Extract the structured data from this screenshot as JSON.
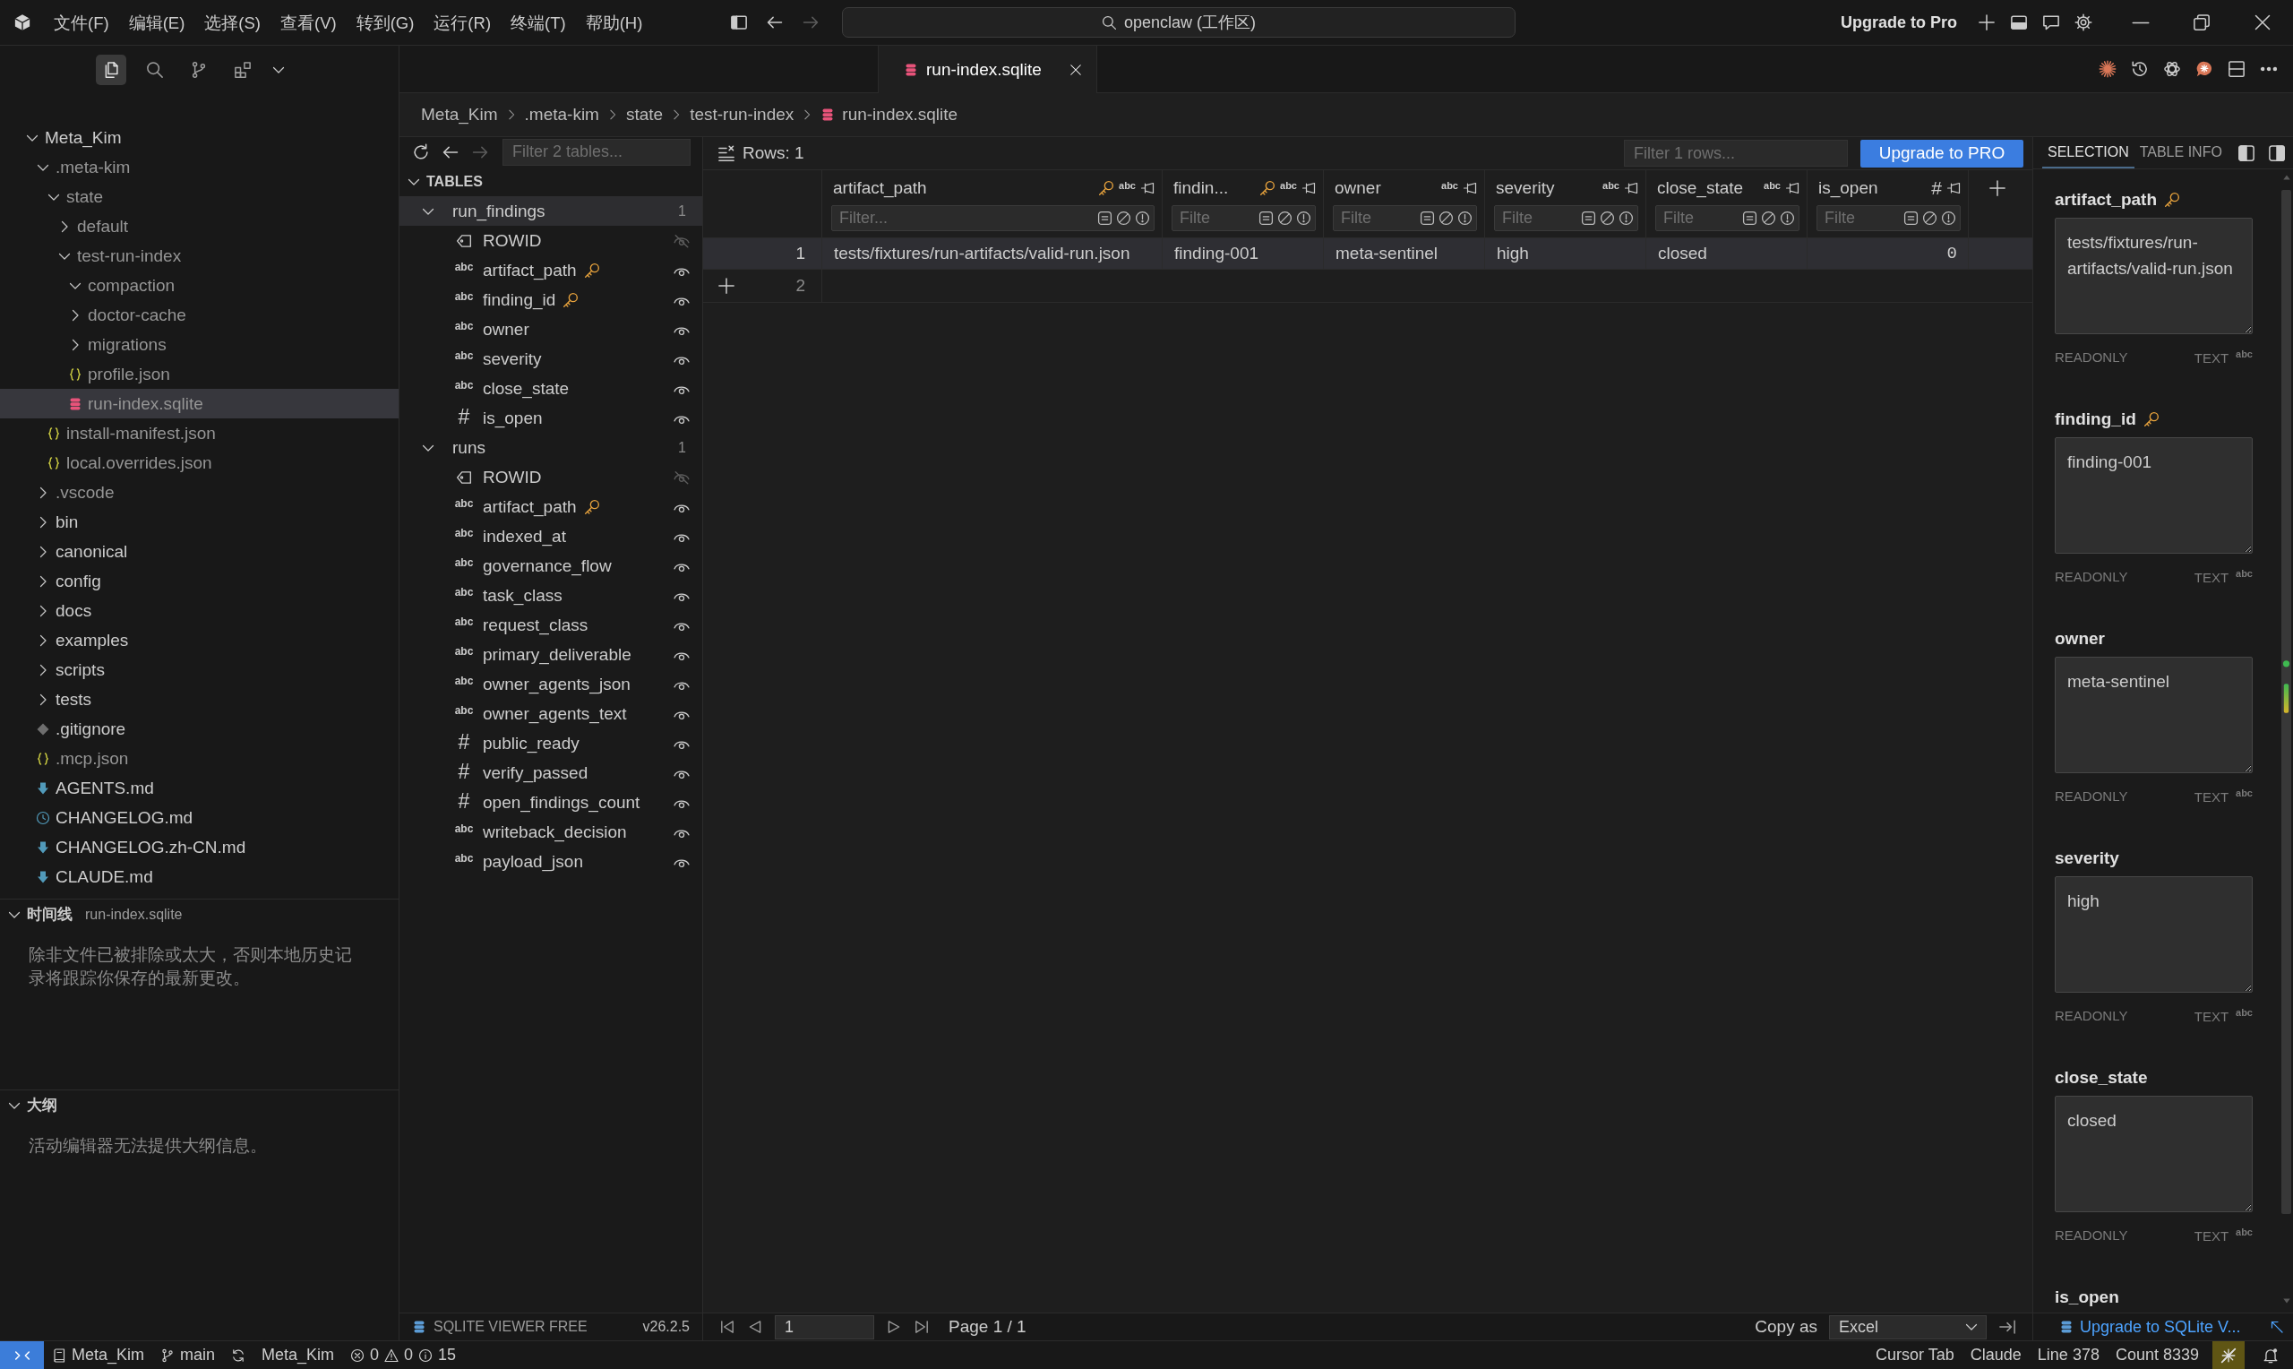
{
  "title_bar": {
    "menu": [
      "文件(F)",
      "编辑(E)",
      "选择(S)",
      "查看(V)",
      "转到(G)",
      "运行(R)",
      "终端(T)",
      "帮助(H)"
    ],
    "search": "openclaw (工作区)",
    "upgrade": "Upgrade to Pro"
  },
  "sidebar": {
    "views": [
      {
        "kind": "explorer",
        "selected": true
      },
      {
        "kind": "search",
        "selected": false
      },
      {
        "kind": "source-control",
        "selected": false
      },
      {
        "kind": "extensions",
        "selected": false
      }
    ],
    "tree": [
      {
        "label": "Meta_Kim",
        "kind": "folder",
        "expanded": true,
        "dimmed": false,
        "selected": false,
        "children": [
          {
            "label": ".meta-kim",
            "kind": "folder",
            "expanded": true,
            "dimmed": true,
            "selected": false,
            "children": [
              {
                "label": "state",
                "kind": "folder",
                "expanded": true,
                "dimmed": true,
                "selected": false,
                "children": [
                  {
                    "label": "default",
                    "kind": "folder",
                    "expanded": false,
                    "dimmed": true,
                    "selected": false
                  },
                  {
                    "label": "test-run-index",
                    "kind": "folder",
                    "expanded": true,
                    "dimmed": true,
                    "selected": false,
                    "children": [
                      {
                        "label": "compaction",
                        "kind": "folder",
                        "expanded": true,
                        "dimmed": true,
                        "selected": false
                      },
                      {
                        "label": "doctor-cache",
                        "kind": "folder",
                        "expanded": false,
                        "dimmed": true,
                        "selected": false
                      },
                      {
                        "label": "migrations",
                        "kind": "folder",
                        "expanded": false,
                        "dimmed": true,
                        "selected": false
                      },
                      {
                        "label": "profile.json",
                        "kind": "json",
                        "dimmed": true,
                        "selected": false
                      },
                      {
                        "label": "run-index.sqlite",
                        "kind": "sqlite",
                        "dimmed": true,
                        "selected": true
                      }
                    ]
                  }
                ]
              },
              {
                "label": "install-manifest.json",
                "kind": "json",
                "dimmed": true,
                "selected": false
              },
              {
                "label": "local.overrides.json",
                "kind": "json",
                "dimmed": true,
                "selected": false
              }
            ]
          },
          {
            "label": ".vscode",
            "kind": "folder",
            "expanded": false,
            "dimmed": true,
            "selected": false
          },
          {
            "label": "bin",
            "kind": "folder",
            "expanded": false,
            "dimmed": false,
            "selected": false
          },
          {
            "label": "canonical",
            "kind": "folder",
            "expanded": false,
            "dimmed": false,
            "selected": false
          },
          {
            "label": "config",
            "kind": "folder",
            "expanded": false,
            "dimmed": false,
            "selected": false
          },
          {
            "label": "docs",
            "kind": "folder",
            "expanded": false,
            "dimmed": false,
            "selected": false
          },
          {
            "label": "examples",
            "kind": "folder",
            "expanded": false,
            "dimmed": false,
            "selected": false
          },
          {
            "label": "scripts",
            "kind": "folder",
            "expanded": false,
            "dimmed": false,
            "selected": false
          },
          {
            "label": "tests",
            "kind": "folder",
            "expanded": false,
            "dimmed": false,
            "selected": false
          },
          {
            "label": ".gitignore",
            "kind": "git",
            "dimmed": false,
            "selected": false
          },
          {
            "label": ".mcp.json",
            "kind": "json",
            "dimmed": true,
            "selected": false
          },
          {
            "label": "AGENTS.md",
            "kind": "markdown",
            "dimmed": false,
            "selected": false
          },
          {
            "label": "CHANGELOG.md",
            "kind": "changelog",
            "dimmed": false,
            "selected": false
          },
          {
            "label": "CHANGELOG.zh-CN.md",
            "kind": "markdown",
            "dimmed": false,
            "selected": false
          },
          {
            "label": "CLAUDE.md",
            "kind": "markdown",
            "dimmed": false,
            "selected": false
          }
        ]
      }
    ],
    "timeline": {
      "title": "时间线",
      "expanded": true,
      "file": "run-index.sqlite",
      "message": "除非文件已被排除或太大，否则本地历史记录将跟踪你保存的最新更改。"
    },
    "outline": {
      "title": "大纲",
      "expanded": true,
      "message": "活动编辑器无法提供大纲信息。"
    }
  },
  "editor": {
    "tabs": [
      {
        "label": "run-index.sqlite",
        "kind": "sqlite",
        "selected": true
      }
    ],
    "breadcrumb": [
      {
        "label": "Meta_Kim",
        "kind": "folder"
      },
      {
        "label": ".meta-kim",
        "kind": "folder"
      },
      {
        "label": "state",
        "kind": "folder"
      },
      {
        "label": "test-run-index",
        "kind": "folder"
      },
      {
        "label": "run-index.sqlite",
        "kind": "sqlite"
      }
    ]
  },
  "tables_panel": {
    "filter_placeholder": "Filter 2 tables...",
    "heading": "TABLES",
    "expanded": true,
    "tables": [
      {
        "name": "run_findings",
        "count": "1",
        "expanded": true,
        "selected": true,
        "columns": [
          {
            "name": "ROWID",
            "kind": "rowid",
            "key": false,
            "visible": false
          },
          {
            "name": "artifact_path",
            "kind": "text",
            "type_label": "abc",
            "key": true,
            "visible": true
          },
          {
            "name": "finding_id",
            "kind": "text",
            "type_label": "abc",
            "key": true,
            "visible": true
          },
          {
            "name": "owner",
            "kind": "text",
            "type_label": "abc",
            "key": false,
            "visible": true
          },
          {
            "name": "severity",
            "kind": "text",
            "type_label": "abc",
            "key": false,
            "visible": true
          },
          {
            "name": "close_state",
            "kind": "text",
            "type_label": "abc",
            "key": false,
            "visible": true
          },
          {
            "name": "is_open",
            "kind": "integer",
            "type_label": "#",
            "key": false,
            "visible": true
          }
        ]
      },
      {
        "name": "runs",
        "count": "1",
        "expanded": true,
        "selected": false,
        "columns": [
          {
            "name": "ROWID",
            "kind": "rowid",
            "key": false,
            "visible": false
          },
          {
            "name": "artifact_path",
            "kind": "text",
            "type_label": "abc",
            "key": true,
            "visible": true
          },
          {
            "name": "indexed_at",
            "kind": "text",
            "type_label": "abc",
            "key": false,
            "visible": true
          },
          {
            "name": "governance_flow",
            "kind": "text",
            "type_label": "abc",
            "key": false,
            "visible": true
          },
          {
            "name": "task_class",
            "kind": "text",
            "type_label": "abc",
            "key": false,
            "visible": true
          },
          {
            "name": "request_class",
            "kind": "text",
            "type_label": "abc",
            "key": false,
            "visible": true
          },
          {
            "name": "primary_deliverable",
            "kind": "text",
            "type_label": "abc",
            "key": false,
            "visible": true
          },
          {
            "name": "owner_agents_json",
            "kind": "text",
            "type_label": "abc",
            "key": false,
            "visible": true
          },
          {
            "name": "owner_agents_text",
            "kind": "text",
            "type_label": "abc",
            "key": false,
            "visible": true
          },
          {
            "name": "public_ready",
            "kind": "integer",
            "type_label": "#",
            "key": false,
            "visible": true
          },
          {
            "name": "verify_passed",
            "kind": "integer",
            "type_label": "#",
            "key": false,
            "visible": true
          },
          {
            "name": "open_findings_count",
            "kind": "integer",
            "type_label": "#",
            "key": false,
            "visible": true
          },
          {
            "name": "writeback_decision",
            "kind": "text",
            "type_label": "abc",
            "key": false,
            "visible": true
          },
          {
            "name": "payload_json",
            "kind": "text",
            "type_label": "abc",
            "key": false,
            "visible": true
          }
        ]
      }
    ]
  },
  "grid": {
    "rows_label": "Rows: 1",
    "filter_placeholder": "Filter 1 rows...",
    "upgrade_button": "Upgrade to PRO",
    "columns": [
      {
        "name": "artifact_path",
        "kind": "text",
        "type_label": "abc",
        "key": true,
        "filter_placeholder": "Filter..."
      },
      {
        "name": "findin...",
        "kind": "text",
        "type_label": "abc",
        "key": true,
        "filter_placeholder": "Filte"
      },
      {
        "name": "owner",
        "kind": "text",
        "type_label": "abc",
        "key": false,
        "filter_placeholder": "Filte"
      },
      {
        "name": "severity",
        "kind": "text",
        "type_label": "abc",
        "key": false,
        "filter_placeholder": "Filte"
      },
      {
        "name": "close_state",
        "kind": "text",
        "type_label": "abc",
        "key": false,
        "filter_placeholder": "Filte"
      },
      {
        "name": "is_open",
        "kind": "integer",
        "type_label": "#",
        "key": false,
        "filter_placeholder": "Filte"
      }
    ],
    "rows": [
      {
        "number": "1",
        "selected": true,
        "cells": [
          "tests/fixtures/run-artifacts/valid-run.json",
          "finding-001",
          "meta-sentinel",
          "high",
          "closed",
          "0"
        ]
      }
    ],
    "new_row_number": "2"
  },
  "details": {
    "tabs": [
      {
        "label": "SELECTION",
        "selected": true
      },
      {
        "label": "TABLE INFO",
        "selected": false
      }
    ],
    "fields": [
      {
        "name": "artifact_path",
        "key": true,
        "value": "tests/fixtures/run-artifacts/valid-run.json",
        "access": "READONLY",
        "type": "TEXT $^{abc}$"
      },
      {
        "name": "finding_id",
        "key": true,
        "value": "finding-001",
        "access": "READONLY",
        "type": "TEXT $^{abc}$"
      },
      {
        "name": "owner",
        "key": false,
        "value": "meta-sentinel",
        "access": "READONLY",
        "type": "TEXT $^{abc}$"
      },
      {
        "name": "severity",
        "key": false,
        "value": "high",
        "access": "READONLY",
        "type": "TEXT $^{abc}$"
      },
      {
        "name": "close_state",
        "key": false,
        "value": "closed",
        "access": "READONLY",
        "type": "TEXT $^{abc}$"
      },
      {
        "name": "is_open",
        "key": false
      }
    ]
  },
  "viewer_footer": {
    "product": "SQLITE VIEWER FREE",
    "version": "v26.2.5",
    "page": "1",
    "page_label": "Page 1 / 1",
    "copy_label": "Copy as",
    "format": "Excel",
    "upgrade_link": "Upgrade to SQLite V..."
  },
  "status_bar": {
    "left": [
      {
        "kind": "remote"
      },
      {
        "kind": "workspace",
        "label": "Meta_Kim"
      },
      {
        "kind": "branch",
        "label": "main"
      },
      {
        "kind": "sync"
      },
      {
        "kind": "text",
        "label": "Meta_Kim"
      },
      {
        "kind": "problems",
        "errors": "0",
        "warnings": "0",
        "infos": "15"
      }
    ],
    "right": [
      {
        "kind": "text",
        "label": "Cursor Tab"
      },
      {
        "kind": "text",
        "label": "Claude"
      },
      {
        "kind": "text",
        "label": "Line 378"
      },
      {
        "kind": "text",
        "label": "Count 8339"
      },
      {
        "kind": "ai-off"
      },
      {
        "kind": "notifications"
      }
    ]
  }
}
